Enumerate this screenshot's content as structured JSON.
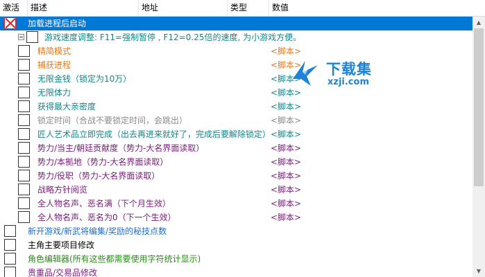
{
  "header": {
    "col_active": "激活",
    "col_desc": "描述",
    "col_address": "地址",
    "col_type": "类型",
    "col_value": "数值"
  },
  "colors": {
    "orange": "#e07a1f",
    "teal": "#11878a",
    "purple": "#7a1a7a",
    "gray": "#8a8a8a",
    "blue": "#1e6fd0",
    "selection": "#0078d7",
    "black": "#000000"
  },
  "rows": [
    {
      "desc": "加载进程后启动",
      "value": "",
      "checked": true,
      "color": "#ffffff",
      "selected": true
    },
    {
      "desc": "游戏速度调整:  F11=强制暂停 , F12=0.25倍的速度, 为小游戏方便。",
      "value": "",
      "checked": false,
      "color": "#11878a",
      "expander": true
    },
    {
      "desc": "精简模式",
      "value": "<脚本>",
      "checked": false,
      "color": "#e07a1f"
    },
    {
      "desc": "捕获进程",
      "value": "<脚本>",
      "checked": false,
      "color": "#e07a1f"
    },
    {
      "desc": "无限金钱（锁定为10万）",
      "value": "<脚本>",
      "checked": false,
      "color": "#11878a"
    },
    {
      "desc": "无限体力",
      "value": "<脚本>",
      "checked": false,
      "color": "#11878a"
    },
    {
      "desc": "获得最大亲密度",
      "value": "<脚本>",
      "checked": false,
      "color": "#11878a"
    },
    {
      "desc": "锁定时间（合战不要锁定时间，会跳出）",
      "value": "<脚本>",
      "checked": false,
      "color": "#8a8a8a"
    },
    {
      "desc": "匠人艺术品立即完成（出去再进来就好了，完成后要解除锁定）",
      "value": "<脚本>",
      "checked": false,
      "color": "#11878a"
    },
    {
      "desc": "势力/当主/朝廷贡献度（势力-大名界面读取）",
      "value": "<脚本>",
      "checked": false,
      "color": "#7a1a7a"
    },
    {
      "desc": "势力/本拠地（势力-大名界面读取）",
      "value": "<脚本>",
      "checked": false,
      "color": "#7a1a7a"
    },
    {
      "desc": "势力/役职（势力-大名界面读取）",
      "value": "<脚本>",
      "checked": false,
      "color": "#7a1a7a"
    },
    {
      "desc": "战略方针阅览",
      "value": "<脚本>",
      "checked": false,
      "color": "#7a1a7a"
    },
    {
      "desc": "全人物名声、恶名满（下个月生效）",
      "value": "<脚本>",
      "checked": false,
      "color": "#7a1a7a"
    },
    {
      "desc": "全人物名声、恶名为0（下一个生效）",
      "value": "<脚本>",
      "checked": false,
      "color": "#7a1a7a"
    },
    {
      "desc": "新开游戏/新武将编集/奖励的秘技点数",
      "value": "",
      "checked": false,
      "color": "#1e6fd0",
      "root": true
    },
    {
      "desc": "主角主要项目修改",
      "value": "",
      "checked": false,
      "color": "#000000",
      "root": true
    },
    {
      "desc": "角色编辑器(所有这些都需要使用字符统计显示)",
      "value": "",
      "checked": false,
      "color": "#2a8a1a",
      "root": true
    },
    {
      "desc": "贵重品/交易品修改",
      "value": "",
      "checked": false,
      "color": "#7a1a7a",
      "root": true
    }
  ],
  "watermark": {
    "brand": "下载集",
    "url": "xzji.com"
  },
  "scrollbar": {
    "up_icon": "▲",
    "down_icon": "▼",
    "position": 0.0
  }
}
